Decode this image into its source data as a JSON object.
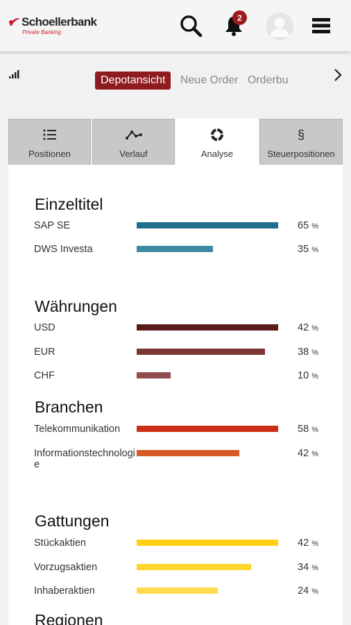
{
  "header": {
    "brand": "Schoellerbank",
    "brand_sub": "Private Banking",
    "notification_count": "2",
    "icons": [
      "search-icon",
      "bell-icon",
      "avatar-icon",
      "menu-icon"
    ]
  },
  "subnav": {
    "signal_icon": "signal-icon",
    "active": "Depotansicht",
    "items": [
      "Neue Order",
      "Orderbu"
    ],
    "next_icon": "chevron-right-icon"
  },
  "tabs": [
    {
      "label": "Positionen",
      "icon": "list-icon"
    },
    {
      "label": "Verlauf",
      "icon": "line-chart-icon"
    },
    {
      "label": "Analyse",
      "icon": "donut-icon",
      "active": true
    },
    {
      "label": "Steuerpositionen",
      "icon": "§"
    }
  ],
  "colors": {
    "accent": "#8e1b1e",
    "einzeltitel": [
      "#1f6e8c",
      "#3d8aa5"
    ],
    "waehrungen": [
      "#5b1a1c",
      "#7c3537",
      "#8f4d50"
    ],
    "branchen": [
      "#cc2f18",
      "#d45a28"
    ],
    "gattungen": [
      "#ffcf10",
      "#ffd52e",
      "#ffda4d"
    ]
  },
  "sections": [
    {
      "title": "Einzeltitel",
      "rows": [
        {
          "label": "SAP SE",
          "value": 65,
          "pct": "65",
          "unit": "%"
        },
        {
          "label": "DWS Investa",
          "value": 35,
          "pct": "35",
          "unit": "%"
        }
      ]
    },
    {
      "title": "Währungen",
      "rows": [
        {
          "label": "USD",
          "value": 42,
          "pct": "42",
          "unit": "%"
        },
        {
          "label": "EUR",
          "value": 38,
          "pct": "38",
          "unit": "%"
        },
        {
          "label": "CHF",
          "value": 10,
          "pct": "10",
          "unit": "%"
        }
      ]
    },
    {
      "title": "Branchen",
      "rows": [
        {
          "label": "Telekommunikation",
          "value": 58,
          "pct": "58",
          "unit": "%"
        },
        {
          "label": "Informationstechnologie",
          "value": 42,
          "pct": "42",
          "unit": "%"
        }
      ]
    },
    {
      "title": "Gattungen",
      "rows": [
        {
          "label": "Stückaktien",
          "value": 42,
          "pct": "42",
          "unit": "%"
        },
        {
          "label": "Vorzugsaktien",
          "value": 34,
          "pct": "34",
          "unit": "%"
        },
        {
          "label": "Inhaberaktien",
          "value": 24,
          "pct": "24",
          "unit": "%"
        }
      ]
    },
    {
      "title": "Regionen",
      "rows": []
    }
  ]
}
